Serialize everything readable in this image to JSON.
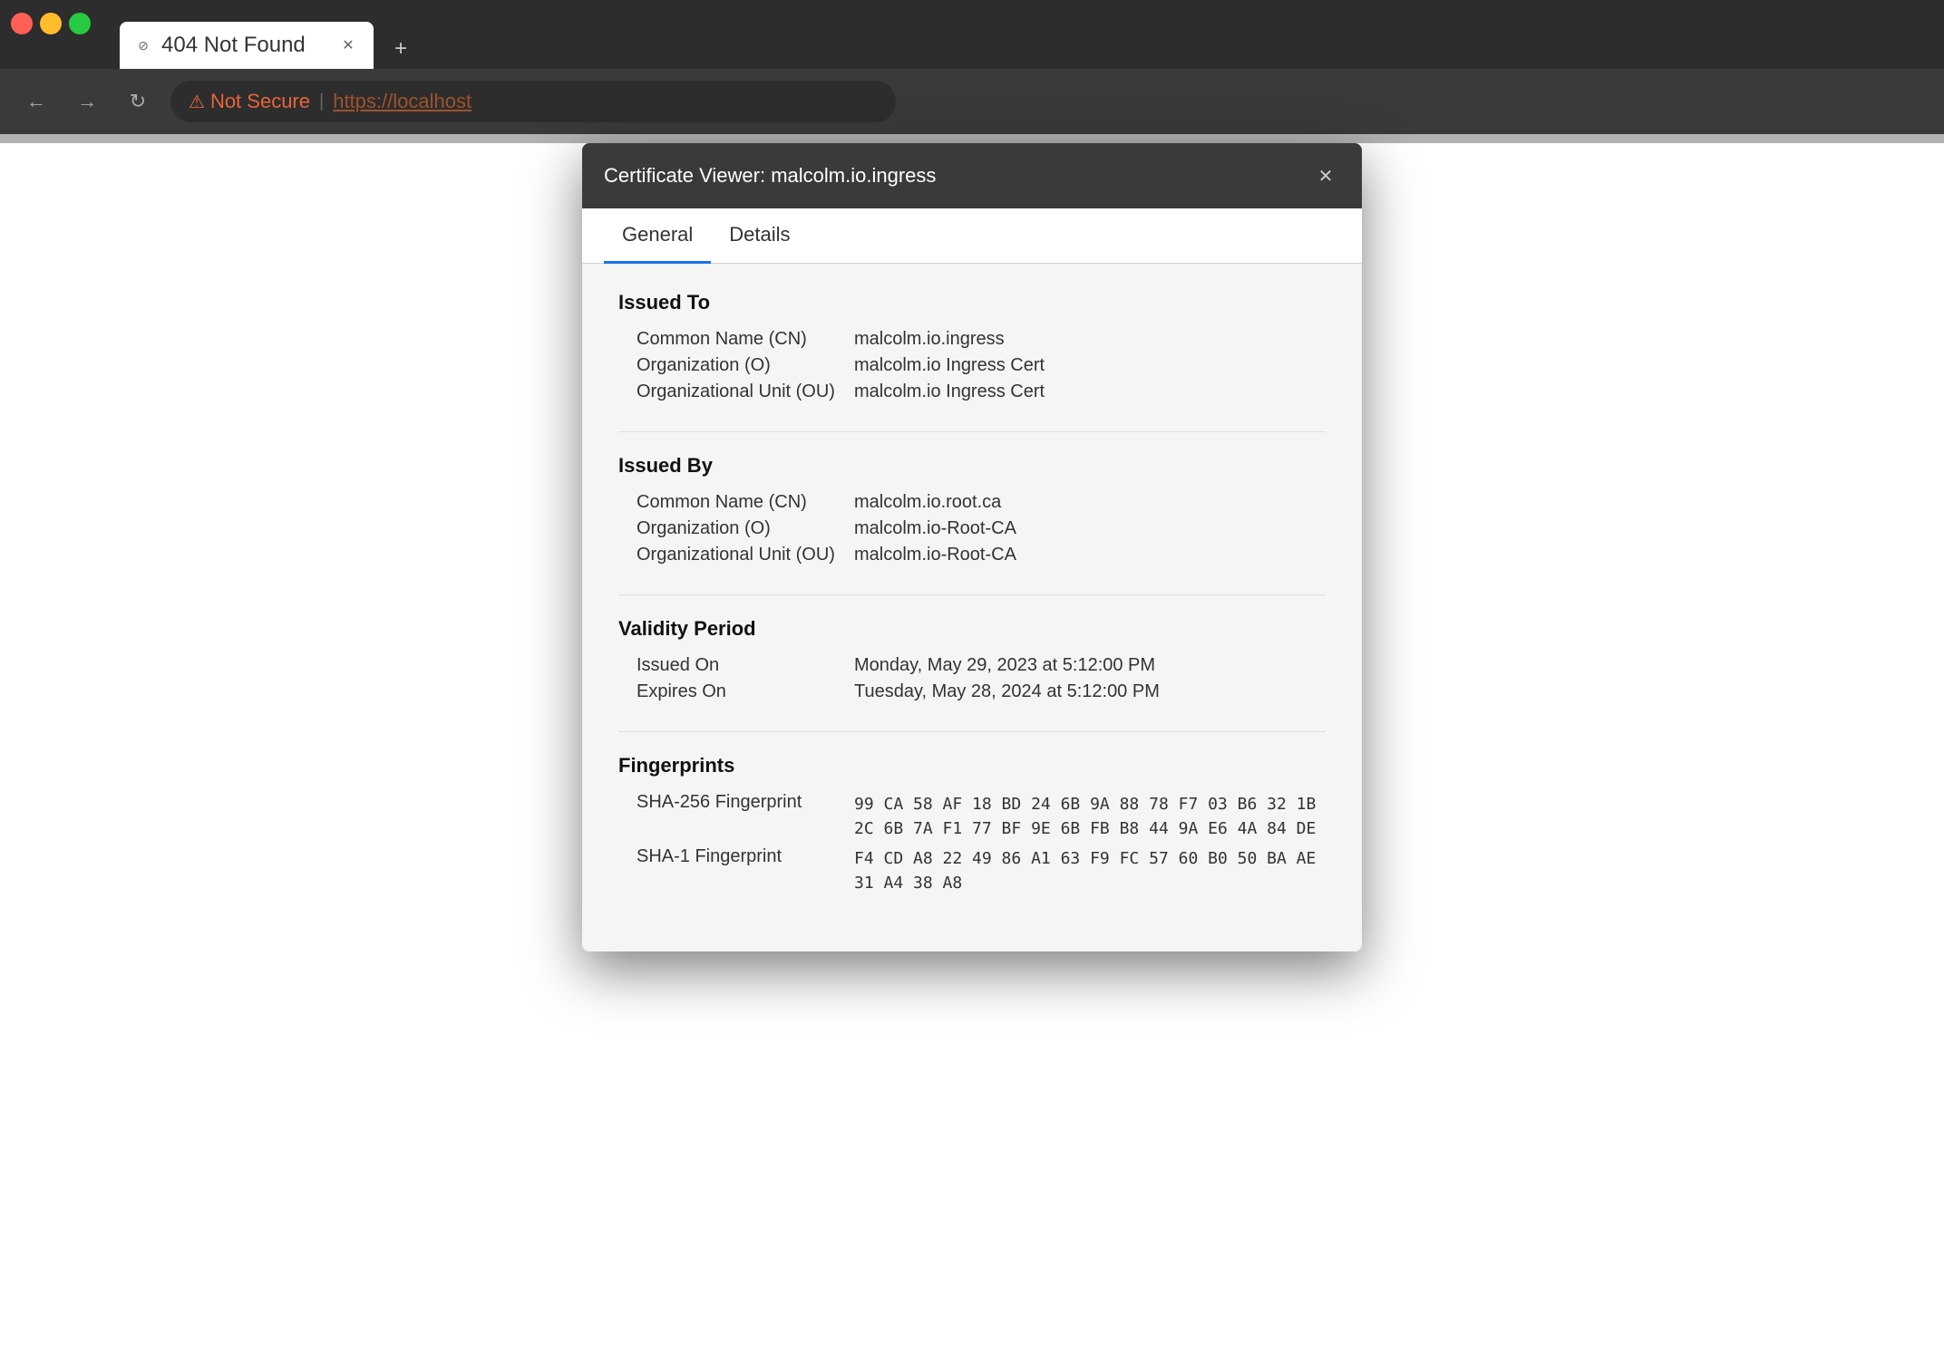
{
  "browser": {
    "tab": {
      "title": "404 Not Found",
      "favicon": "⊘"
    },
    "new_tab_label": "+",
    "nav": {
      "back": "←",
      "forward": "→",
      "reload": "↻"
    },
    "address_bar": {
      "security_label": "Not Secure",
      "separator": "|",
      "url": "https://localhost"
    }
  },
  "certificate_viewer": {
    "title": "Certificate Viewer: malcolm.io.ingress",
    "close_icon": "✕",
    "tabs": [
      {
        "label": "General",
        "active": true
      },
      {
        "label": "Details",
        "active": false
      }
    ],
    "sections": {
      "issued_to": {
        "title": "Issued To",
        "fields": [
          {
            "label": "Common Name (CN)",
            "value": "malcolm.io.ingress"
          },
          {
            "label": "Organization (O)",
            "value": "malcolm.io Ingress Cert"
          },
          {
            "label": "Organizational Unit (OU)",
            "value": "malcolm.io Ingress Cert"
          }
        ]
      },
      "issued_by": {
        "title": "Issued By",
        "fields": [
          {
            "label": "Common Name (CN)",
            "value": "malcolm.io.root.ca"
          },
          {
            "label": "Organization (O)",
            "value": "malcolm.io-Root-CA"
          },
          {
            "label": "Organizational Unit (OU)",
            "value": "malcolm.io-Root-CA"
          }
        ]
      },
      "validity": {
        "title": "Validity Period",
        "fields": [
          {
            "label": "Issued On",
            "value": "Monday, May 29, 2023 at 5:12:00 PM"
          },
          {
            "label": "Expires On",
            "value": "Tuesday, May 28, 2024 at 5:12:00 PM"
          }
        ]
      },
      "fingerprints": {
        "title": "Fingerprints",
        "sha256_label": "SHA-256 Fingerprint",
        "sha256_value": "99 CA 58 AF 18 BD 24 6B 9A 88 78 F7 03 B6 32 1B\n2C 6B 7A F1 77 BF 9E 6B FB B8 44 9A E6 4A 84 DE",
        "sha1_label": "SHA-1 Fingerprint",
        "sha1_value": "F4 CD A8 22 49 86 A1 63 F9 FC 57 60 B0 50 BA AE\n31 A4 38 A8"
      }
    }
  }
}
